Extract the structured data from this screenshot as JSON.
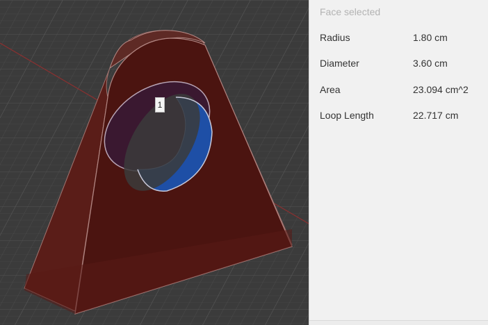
{
  "viewport": {
    "marker_label": "1",
    "colors": {
      "body": "#4b1410",
      "hole": "#1e4fa6",
      "background": "#3b3b3b"
    }
  },
  "panel": {
    "title": "Face selected",
    "properties": [
      {
        "label": "Radius",
        "value": "1.80 cm"
      },
      {
        "label": "Diameter",
        "value": "3.60 cm"
      },
      {
        "label": "Area",
        "value": "23.094 cm^2"
      },
      {
        "label": "Loop Length",
        "value": "22.717 cm"
      }
    ]
  }
}
